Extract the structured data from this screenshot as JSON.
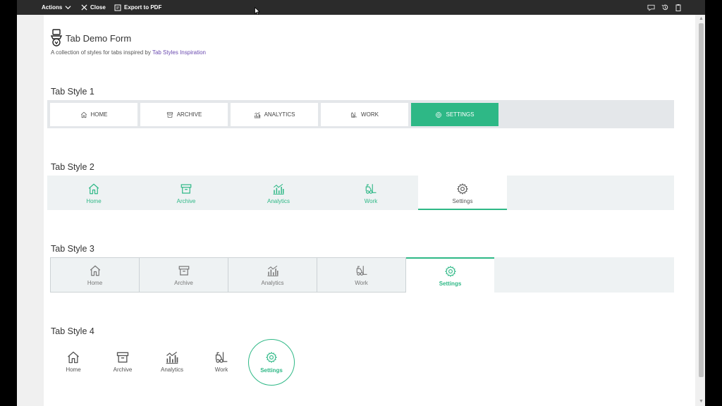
{
  "toolbar": {
    "actions": "Actions",
    "close": "Close",
    "export": "Export to PDF"
  },
  "form": {
    "title": "Tab Demo Form",
    "subtitle_prefix": "A collection of styles for tabs inspired by ",
    "subtitle_link": "Tab Styles Inspiration"
  },
  "sections": {
    "s1": "Tab Style 1",
    "s2": "Tab Style 2",
    "s3": "Tab Style 3",
    "s4": "Tab Style 4"
  },
  "tabs_upper": [
    "HOME",
    "ARCHIVE",
    "ANALYTICS",
    "WORK",
    "SETTINGS"
  ],
  "tabs": [
    "Home",
    "Archive",
    "Analytics",
    "Work",
    "Settings"
  ],
  "icons": [
    "home-icon",
    "archive-icon",
    "analytics-icon",
    "forklift-icon",
    "gear-icon"
  ],
  "colors": {
    "accent": "#2eb886",
    "link": "#6b4bb0",
    "topbar": "#2b2b2b"
  }
}
